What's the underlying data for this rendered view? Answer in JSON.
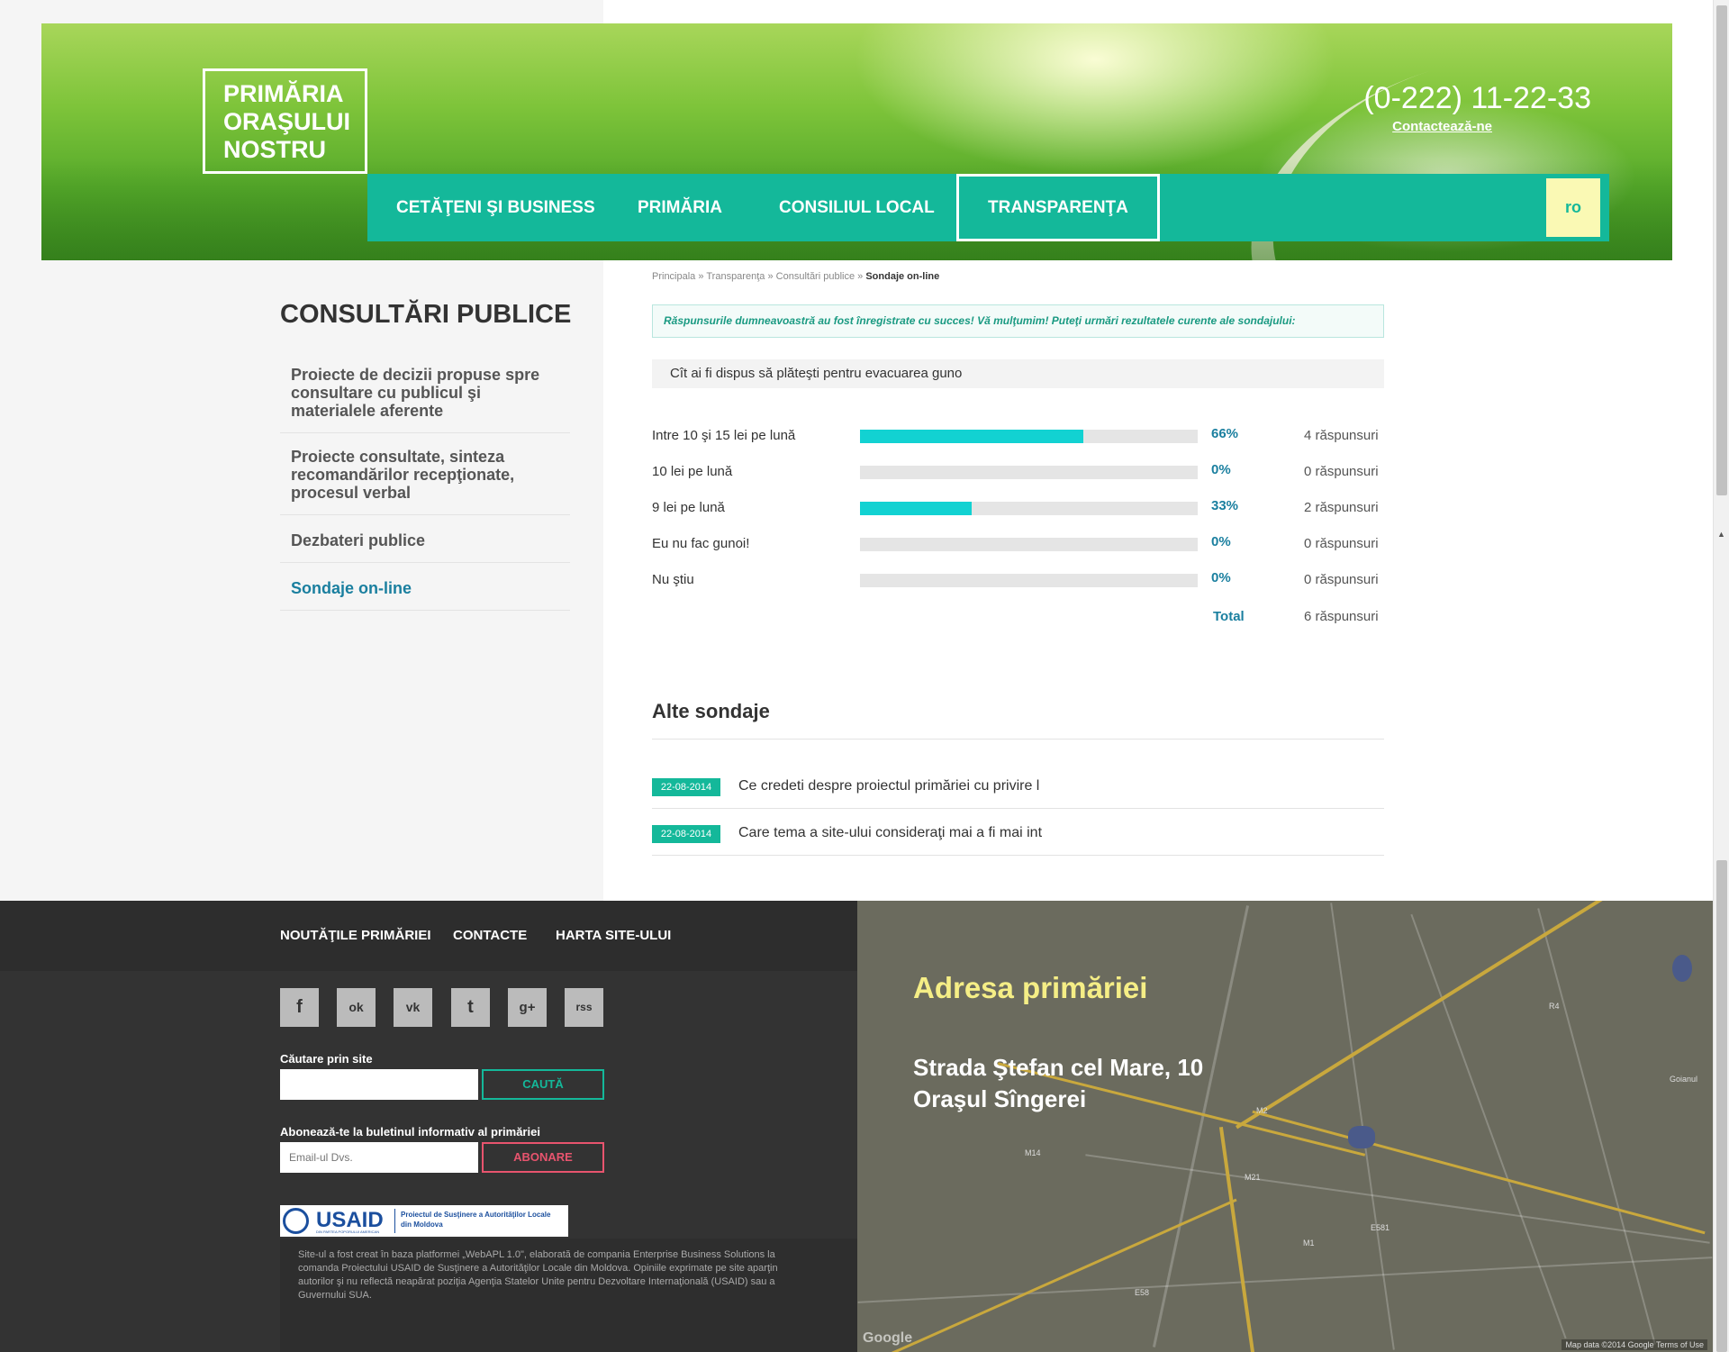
{
  "header": {
    "logo_lines": [
      "PRIMĂRIA",
      "ORAŞULUI",
      "NOSTRU"
    ],
    "phone": "(0-222) 11-22-33",
    "contact_link": "Contactează-ne",
    "nav": [
      {
        "label": "CETĂŢENI ŞI BUSINESS"
      },
      {
        "label": "PRIMĂRIA"
      },
      {
        "label": "CONSILIUL LOCAL"
      },
      {
        "label": "TRANSPARENŢA"
      }
    ],
    "lang": "ro"
  },
  "breadcrumb": {
    "items": [
      "Principala",
      "Transparenţa",
      "Consultări publice"
    ],
    "separator": "»",
    "current": "Sondaje on-line"
  },
  "sidebar": {
    "title": "CONSULTĂRI PUBLICE",
    "items": [
      {
        "label": "Proiecte de decizii propuse spre consultare cu publicul şi materialele aferente"
      },
      {
        "label": "Proiecte consultate, sinteza recomandărilor recepţionate, procesul verbal"
      },
      {
        "label": "Dezbateri publice"
      },
      {
        "label": "Sondaje on-line"
      }
    ],
    "active_index": 3
  },
  "poll": {
    "alert": "Răspunsurile dumneavoastră au fost înregistrate cu succes! Vă mulţumim! Puteţi urmări rezultatele curente ale sondajului:",
    "question": "Cît ai fi dispus să plăteşti pentru evacuarea guno",
    "options": [
      {
        "label": "Intre 10 şi 15 lei pe lună",
        "percent": 66,
        "percent_label": "66%",
        "count": "4 răspunsuri"
      },
      {
        "label": "10 lei pe lună",
        "percent": 0,
        "percent_label": "0%",
        "count": "0 răspunsuri"
      },
      {
        "label": "9 lei pe lună",
        "percent": 33,
        "percent_label": "33%",
        "count": "2 răspunsuri"
      },
      {
        "label": "Eu nu fac gunoi!",
        "percent": 0,
        "percent_label": "0%",
        "count": "0 răspunsuri"
      },
      {
        "label": "Nu ştiu",
        "percent": 0,
        "percent_label": "0%",
        "count": "0 răspunsuri"
      }
    ],
    "total_label": "Total",
    "total_count": "6 răspunsuri"
  },
  "other_polls": {
    "title": "Alte sondaje",
    "items": [
      {
        "date": "22-08-2014",
        "text": "Ce credeti despre proiectul primăriei cu privire l"
      },
      {
        "date": "22-08-2014",
        "text": "Care tema a site-ului consideraţi mai a fi mai int"
      }
    ]
  },
  "footer": {
    "nav": [
      "NOUTĂŢILE PRIMĂRIEI",
      "CONTACTE",
      "HARTA SITE-ULUI"
    ],
    "social": [
      {
        "icon": "facebook-icon",
        "glyph": "f"
      },
      {
        "icon": "odnoklassniki-icon",
        "glyph": "ok"
      },
      {
        "icon": "vkontakte-icon",
        "glyph": "vk"
      },
      {
        "icon": "twitter-icon",
        "glyph": "t"
      },
      {
        "icon": "google-plus-icon",
        "glyph": "g+"
      },
      {
        "icon": "rss-icon",
        "glyph": "rss"
      }
    ],
    "search_label": "Căutare prin site",
    "search_value": "",
    "search_button": "CAUTĂ",
    "subscribe_label": "Abonează-te la buletinul informativ al primăriei",
    "email_placeholder": "Email-ul Dvs.",
    "subscribe_button": "ABONARE",
    "usaid": {
      "name": "USAID",
      "sub": "DIN PARTEA POPORULUI AMERICAN",
      "project": "Proiectul de Susţinere a Autorităţilor Locale din Moldova"
    },
    "note": "Site-ul a fost creat în baza platformei „WebAPL 1.0\", elaborată de compania Enterprise Business Solutions la comanda Proiectului USAID de Susţinere a Autorităţilor Locale din Moldova. Opiniile exprimate pe site aparţin autorilor şi nu reflectă neapărat poziţia Agenţia Statelor Unite pentru Dezvoltare Internaţională (USAID) sau a Guvernului SUA."
  },
  "map": {
    "title": "Adresa primăriei",
    "address_line1": "Strada Ştefan cel Mare, 10",
    "address_line2": "Oraşul Sîngerei",
    "google": "Google",
    "attribution": "Map data ©2014 Google   Terms of Use",
    "labels": [
      "Goianul",
      "M2",
      "M21",
      "M14",
      "R4",
      "E581",
      "E58",
      "M1"
    ]
  },
  "colors": {
    "accent": "#14b89a",
    "link": "#1a7f9f",
    "bar": "#12d2d2",
    "subscribe": "#e8546e",
    "map_title": "#f5ee86"
  }
}
